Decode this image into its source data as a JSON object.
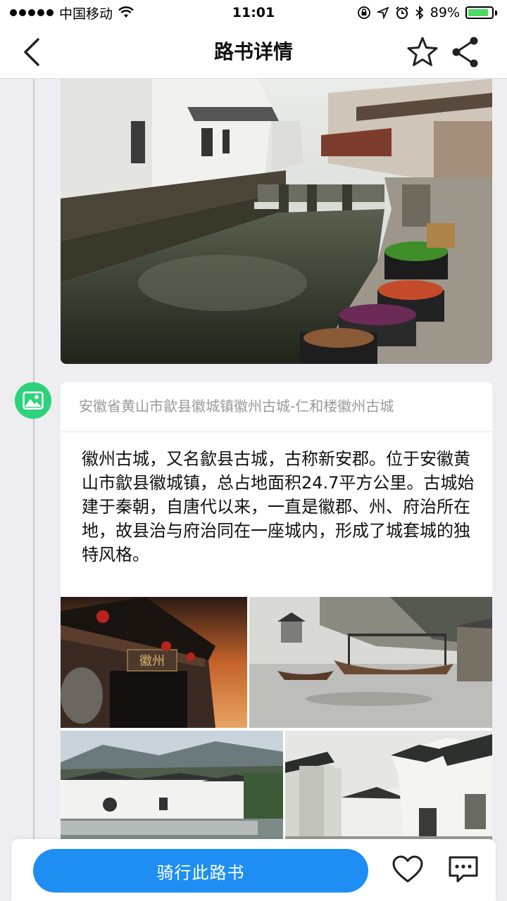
{
  "status_bar": {
    "carrier": "中国移动",
    "time": "11:01",
    "battery_percent_text": "89%",
    "battery_level": 0.89,
    "battery_color": "#4cd964"
  },
  "nav": {
    "title": "路书详情",
    "back_icon": "chevron-left-icon",
    "favorite_icon": "star-outline-icon",
    "share_icon": "share-icon"
  },
  "entry": {
    "marker_icon": "image-icon",
    "marker_color": "#2dd37a",
    "location": "安徽省黄山市歙县徽城镇徽州古城-仁和楼徽州古城",
    "description": "徽州古城，又名歙县古城，古称新安郡。位于安徽黄山市歙县徽城镇，总占地面积24.7平方公里。古城始建于秦朝，自唐代以来，一直是徽郡、州、府治所在地，故县治与府治同在一座城内，形成了城套城的独特风格。",
    "gate_plaque_text": "徽州"
  },
  "bottom_bar": {
    "ride_button_label": "骑行此路书",
    "like_icon": "heart-outline-icon",
    "comment_icon": "comment-icon",
    "accent_color": "#1e8ef2"
  }
}
